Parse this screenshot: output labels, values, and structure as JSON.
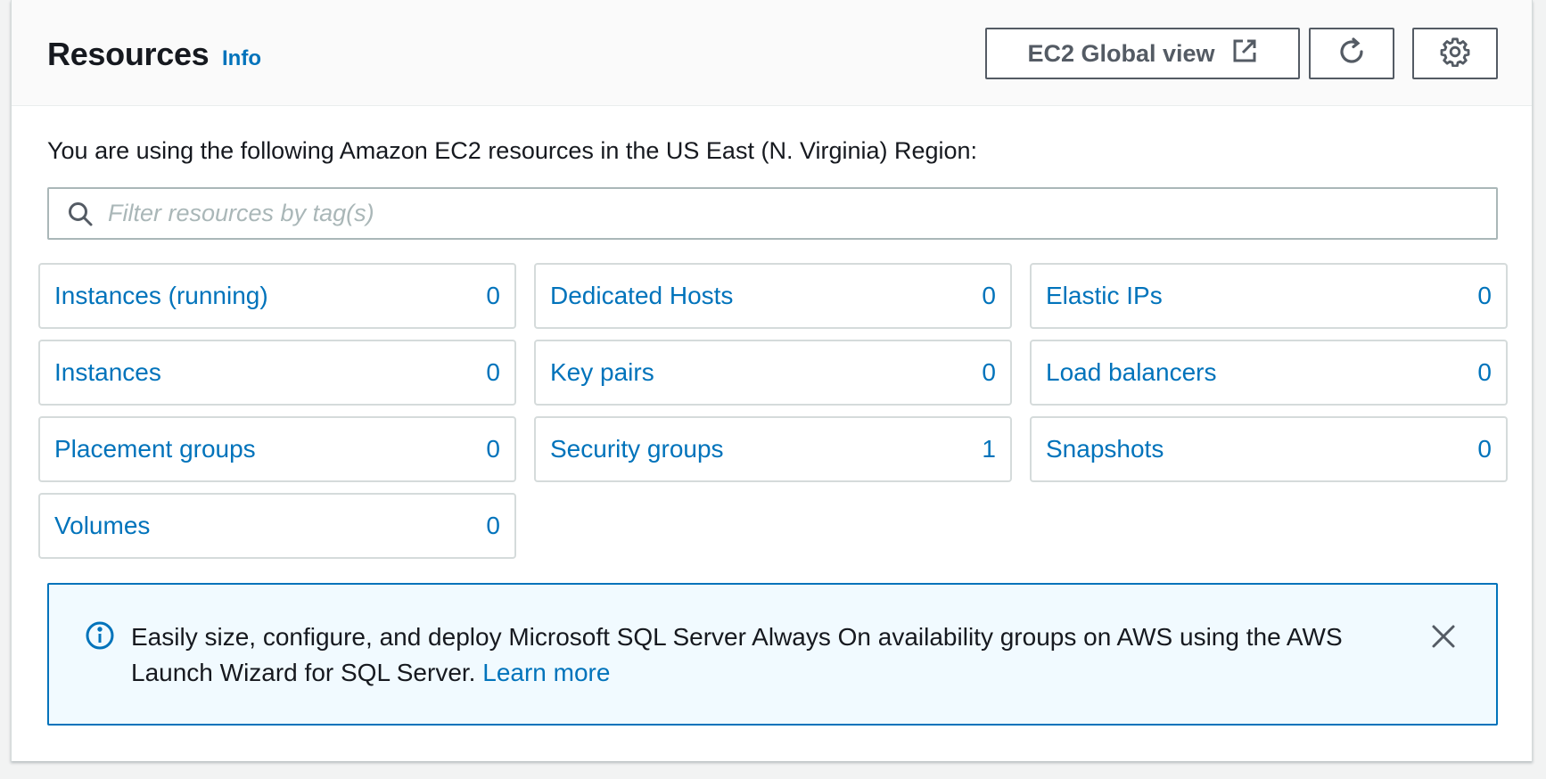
{
  "header": {
    "title": "Resources",
    "info_label": "Info",
    "global_view_label": "EC2 Global view"
  },
  "description": "You are using the following Amazon EC2 resources in the US East (N. Virginia) Region:",
  "filter": {
    "placeholder": "Filter resources by tag(s)",
    "value": ""
  },
  "resources": [
    {
      "name": "Instances (running)",
      "count": "0"
    },
    {
      "name": "Dedicated Hosts",
      "count": "0"
    },
    {
      "name": "Elastic IPs",
      "count": "0"
    },
    {
      "name": "Instances",
      "count": "0"
    },
    {
      "name": "Key pairs",
      "count": "0"
    },
    {
      "name": "Load balancers",
      "count": "0"
    },
    {
      "name": "Placement groups",
      "count": "0"
    },
    {
      "name": "Security groups",
      "count": "1"
    },
    {
      "name": "Snapshots",
      "count": "0"
    },
    {
      "name": "Volumes",
      "count": "0"
    }
  ],
  "flash": {
    "message": "Easily size, configure, and deploy Microsoft SQL Server Always On availability groups on AWS using the AWS Launch Wizard for SQL Server.",
    "link_label": "Learn more"
  },
  "icons": {
    "global_view": "external-link-icon",
    "refresh": "refresh-icon",
    "settings": "gear-icon",
    "search": "search-icon",
    "info": "info-icon",
    "close": "close-icon"
  },
  "colors": {
    "link": "#0073bb",
    "text": "#16191f",
    "button_border": "#545b64",
    "flash_background": "#f1faff",
    "flash_border": "#0073bb"
  }
}
